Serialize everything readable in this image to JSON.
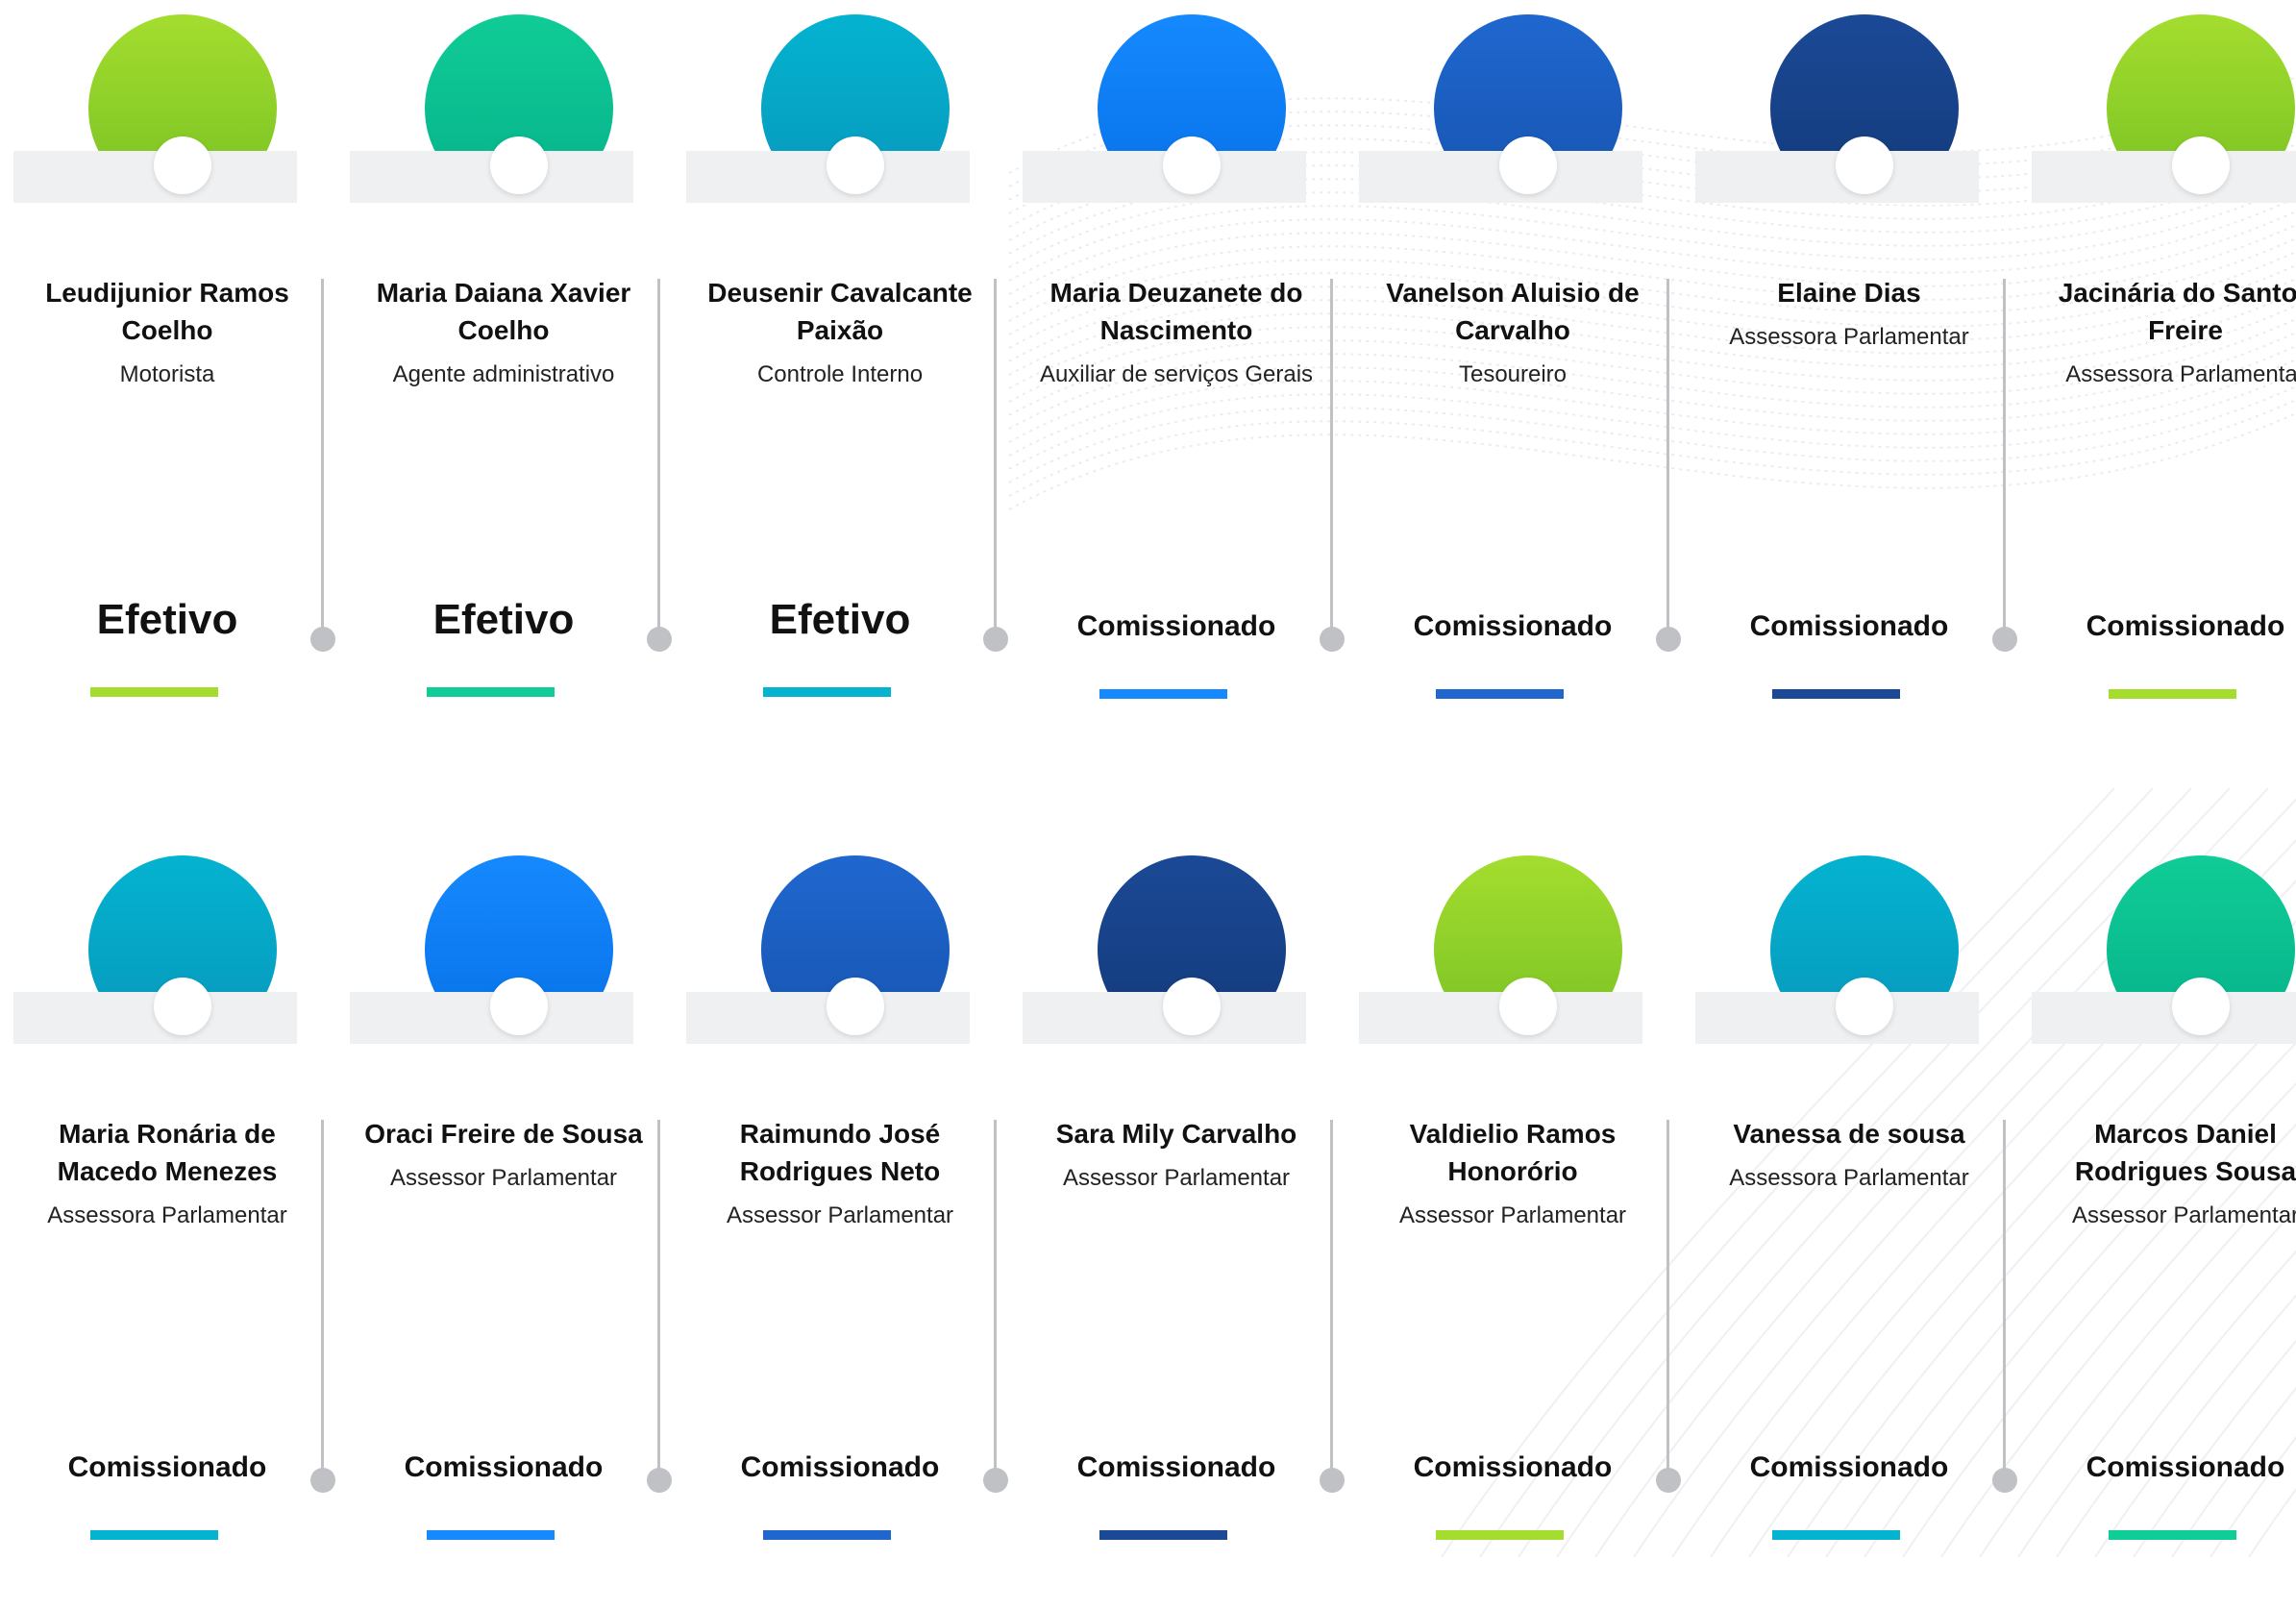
{
  "colors": {
    "lime": "#8fd12a",
    "green": "#0fbf90",
    "teal": "#04a5c9",
    "blue": "#0a7ef3",
    "mid_blue": "#1a5ec2",
    "navy": "#163f8a",
    "connector": "#bfc1c5",
    "pedestal": "#eef0f2"
  },
  "rows": [
    [
      {
        "name": "Leudijunior Ramos Coelho",
        "role": "Motorista",
        "status": "Efetivo",
        "color": "lime"
      },
      {
        "name": "Maria Daiana Xavier Coelho",
        "role": "Agente administrativo",
        "status": "Efetivo",
        "color": "green"
      },
      {
        "name": "Deusenir Cavalcante Paixão",
        "role": "Controle Interno",
        "status": "Efetivo",
        "color": "teal"
      },
      {
        "name": "Maria Deuzanete do Nascimento",
        "role": "Auxiliar de serviços Gerais",
        "status": "Comissionado",
        "color": "blue"
      },
      {
        "name": "Vanelson Aluisio de Carvalho",
        "role": "Tesoureiro",
        "status": "Comissionado",
        "color": "mid_blue"
      },
      {
        "name": "Elaine Dias",
        "role": "Assessora Parlamentar",
        "status": "Comissionado",
        "color": "navy"
      },
      {
        "name": "Jacinária do Santos Freire",
        "role": "Assessora Parlamentar",
        "status": "Comissionado",
        "color": "lime"
      }
    ],
    [
      {
        "name": "Maria Ronária de Macedo Menezes",
        "role": "Assessora Parlamentar",
        "status": "Comissionado",
        "color": "teal"
      },
      {
        "name": "Oraci Freire de Sousa",
        "role": "Assessor Parlamentar",
        "status": "Comissionado",
        "color": "blue"
      },
      {
        "name": "Raimundo José Rodrigues Neto",
        "role": "Assessor Parlamentar",
        "status": "Comissionado",
        "color": "mid_blue"
      },
      {
        "name": "Sara Mily Carvalho",
        "role": "Assessor Parlamentar",
        "status": "Comissionado",
        "color": "navy"
      },
      {
        "name": "Valdielio Ramos Honorório",
        "role": "Assessor Parlamentar",
        "status": "Comissionado",
        "color": "lime"
      },
      {
        "name": "Vanessa de sousa",
        "role": "Assessora Parlamentar",
        "status": "Comissionado",
        "color": "teal"
      },
      {
        "name": "Marcos Daniel Rodrigues Sousa",
        "role": "Assessor Parlamentar",
        "status": "Comissionado",
        "color": "green"
      }
    ]
  ]
}
